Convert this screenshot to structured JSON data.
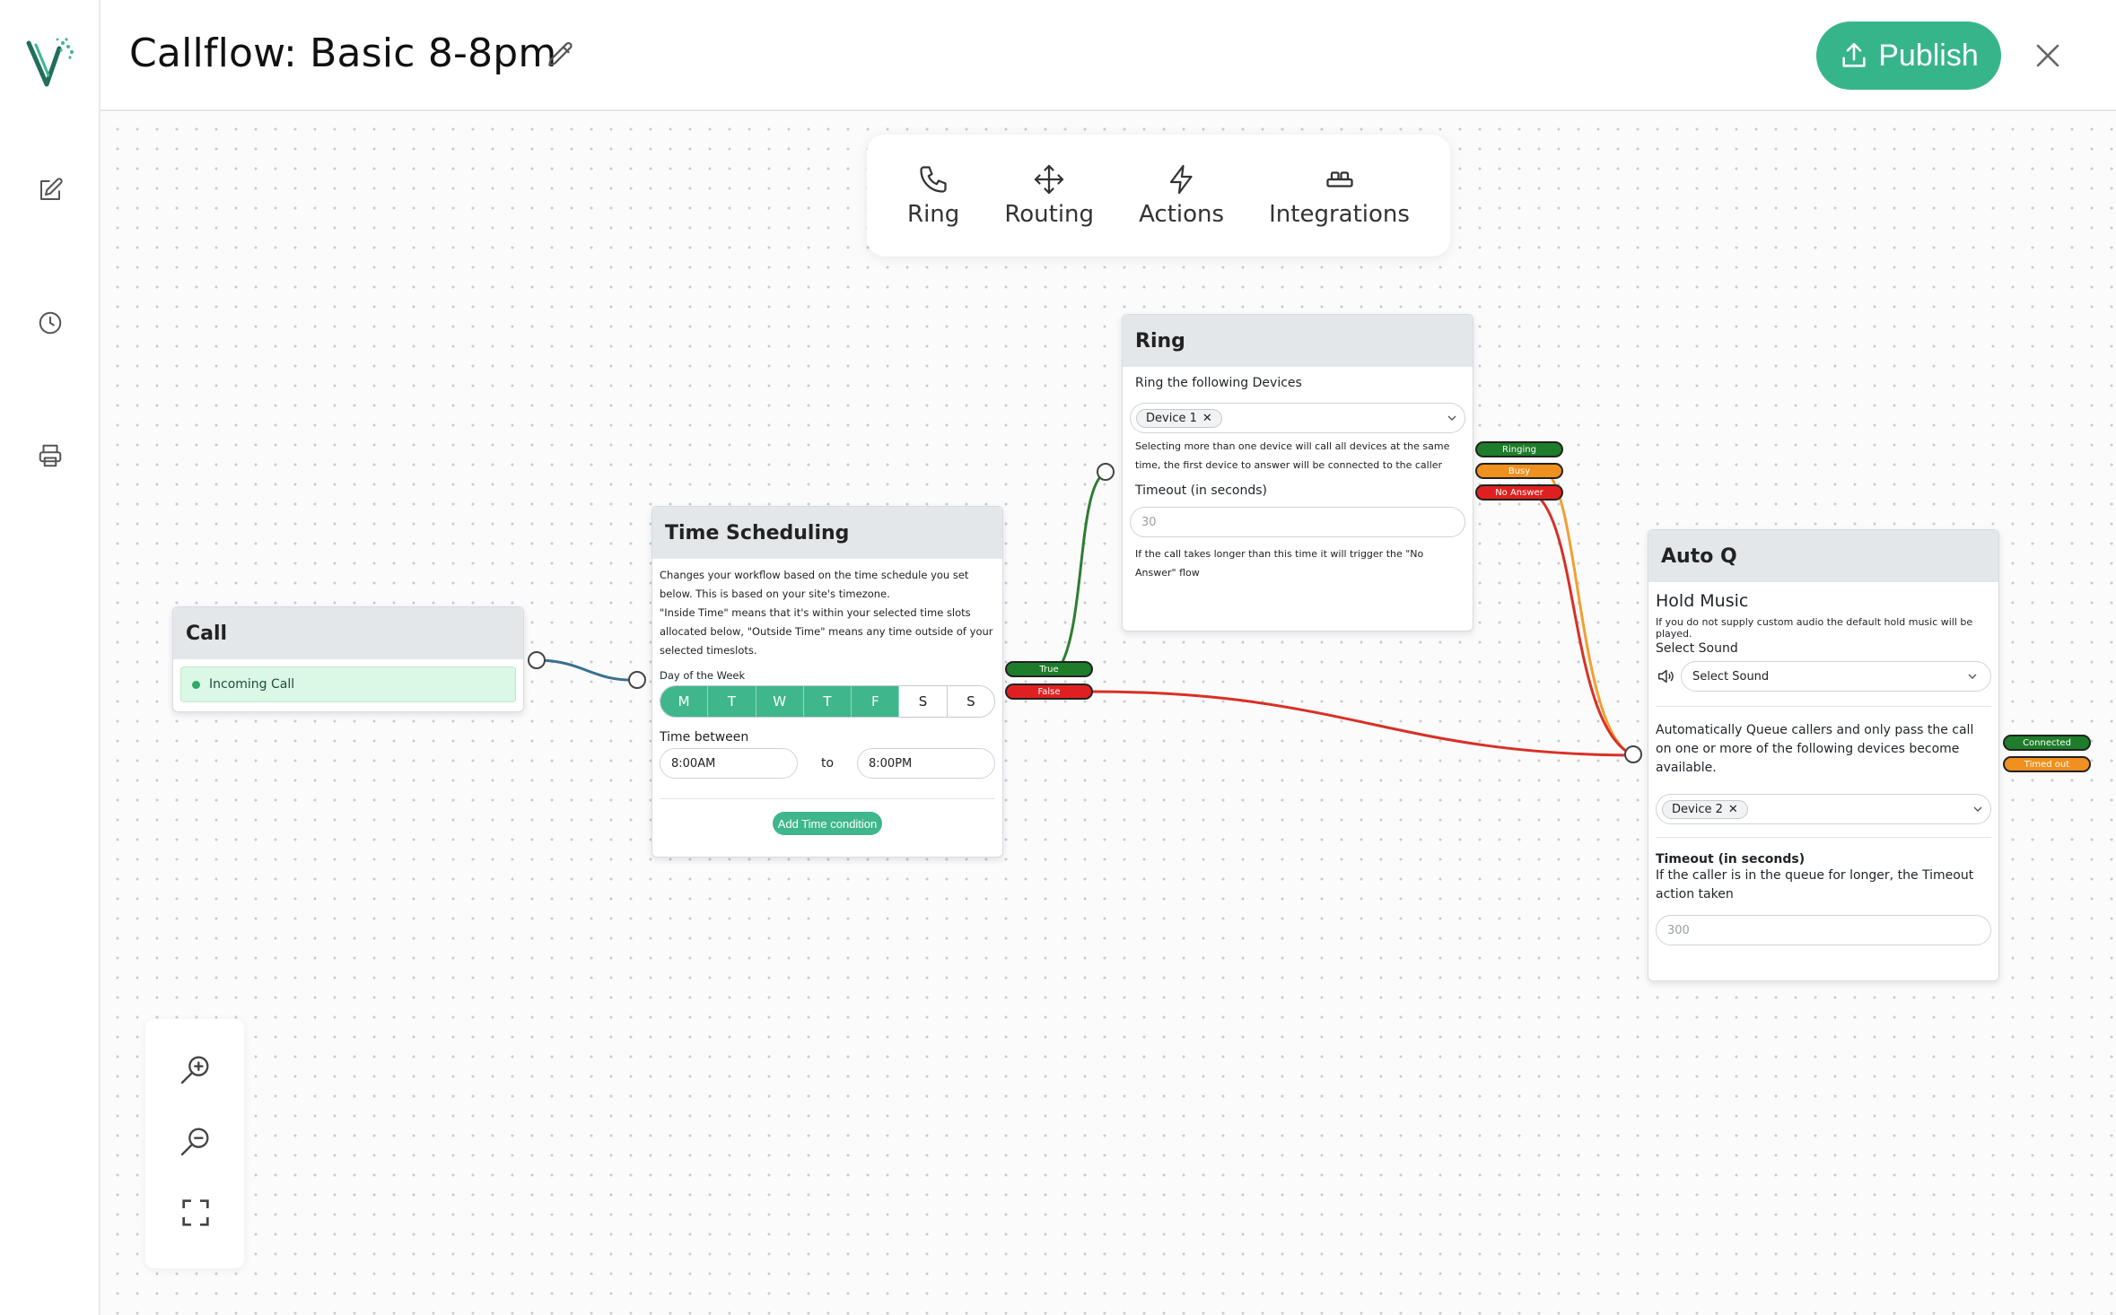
{
  "header": {
    "title": "Callflow: Basic 8-8pm",
    "publish_label": "Publish"
  },
  "palette": {
    "items": [
      {
        "label": "Ring",
        "icon": "phone-icon"
      },
      {
        "label": "Routing",
        "icon": "move-icon"
      },
      {
        "label": "Actions",
        "icon": "lightning-icon"
      },
      {
        "label": "Integrations",
        "icon": "blocks-icon"
      }
    ]
  },
  "nodes": {
    "call": {
      "title": "Call",
      "incoming_label": "Incoming Call"
    },
    "time_scheduling": {
      "title": "Time Scheduling",
      "description": "Changes your workflow based on the time schedule you set below. This is based on your site's timezone.",
      "description2": "\"Inside Time\" means that it's within your selected time slots allocated below, \"Outside Time\" means any time outside of your selected timeslots.",
      "day_label": "Day of the Week",
      "days": [
        "M",
        "T",
        "W",
        "T",
        "F",
        "S",
        "S"
      ],
      "days_selected": [
        true,
        true,
        true,
        true,
        true,
        false,
        false
      ],
      "time_label": "Time between",
      "time_from": "8:00AM",
      "time_to_label": "to",
      "time_to": "8:00PM",
      "add_button": "Add Time condition",
      "outputs": {
        "true": "True",
        "false": "False"
      }
    },
    "ring": {
      "title": "Ring",
      "devices_label": "Ring the following Devices",
      "device_chip": "Device 1",
      "devices_note": "Selecting more than one device will call all devices at the same time, the first device to answer will be connected to the caller",
      "timeout_label": "Timeout (in seconds)",
      "timeout_placeholder": "30",
      "timeout_note": "If the call takes longer than this time it will trigger the \"No Answer\" flow",
      "outputs": {
        "ringing": "Ringing",
        "busy": "Busy",
        "no_answer": "No Answer"
      }
    },
    "autoq": {
      "title": "Auto Q",
      "hold_music_title": "Hold Music",
      "hold_music_note": "If you do not supply custom audio the default hold music will be played.",
      "select_sound_label": "Select Sound",
      "select_sound_placeholder": "Select Sound",
      "queue_text": "Automatically Queue callers and only pass the call on one or more of the following devices become available.",
      "device_chip": "Device 2",
      "timeout_label": "Timeout (in seconds)",
      "timeout_note": "If the caller is in the queue for longer, the Timeout action taken",
      "timeout_placeholder": "300",
      "outputs": {
        "connected": "Connected",
        "timed_out": "Timed out"
      }
    }
  },
  "colors": {
    "accent": "#37b58a",
    "true_tag": "#1e7d2a",
    "false_tag": "#e02020",
    "busy_tag": "#f0901e",
    "edge_blue": "#3a6f91",
    "edge_green": "#2e7d32",
    "edge_red": "#d93025",
    "edge_orange": "#f0a030"
  }
}
